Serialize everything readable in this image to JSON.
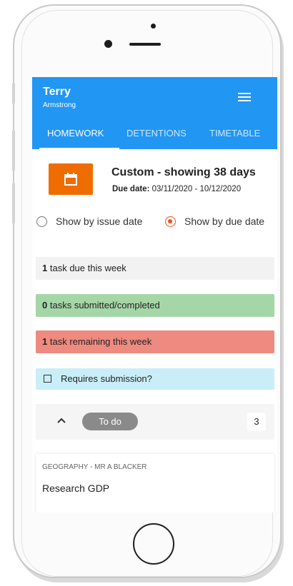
{
  "user": {
    "first_name": "Terry",
    "last_name": "Armstrong"
  },
  "tabs": [
    {
      "label": "HOMEWORK",
      "active": true
    },
    {
      "label": "DETENTIONS",
      "active": false
    },
    {
      "label": "TIMETABLE",
      "active": false
    }
  ],
  "date_range": {
    "title": "Custom - showing 38 days",
    "due_label": "Due date:",
    "due_value": "03/11/2020 - 10/12/2020"
  },
  "view_options": [
    {
      "label": "Show by issue date",
      "selected": false
    },
    {
      "label": "Show by due date",
      "selected": true
    }
  ],
  "summary": {
    "due_count": "1",
    "due_text": "task due this week",
    "submitted_count": "0",
    "submitted_text": "tasks submitted/completed",
    "remaining_count": "1",
    "remaining_text": "task remaining this week"
  },
  "filter": {
    "label": "Requires submission?",
    "checked": false
  },
  "group": {
    "label": "To do",
    "count": "3"
  },
  "tasks": [
    {
      "subject": "GEOGRAPHY - MR A BLACKER",
      "title": "Research GDP"
    }
  ],
  "colors": {
    "primary": "#2196f3",
    "accent": "#ef6c00",
    "radio_selected": "#f4511e",
    "due_bar": "#f2f2f2",
    "submitted_bar": "#a5d6a7",
    "remaining_bar": "#ef8a80",
    "filter_bar": "#c9eef8"
  },
  "icons": {
    "menu": "hamburger-menu-icon",
    "calendar": "calendar-icon",
    "collapse": "chevron-up-icon",
    "checkbox": "checkbox-icon"
  }
}
